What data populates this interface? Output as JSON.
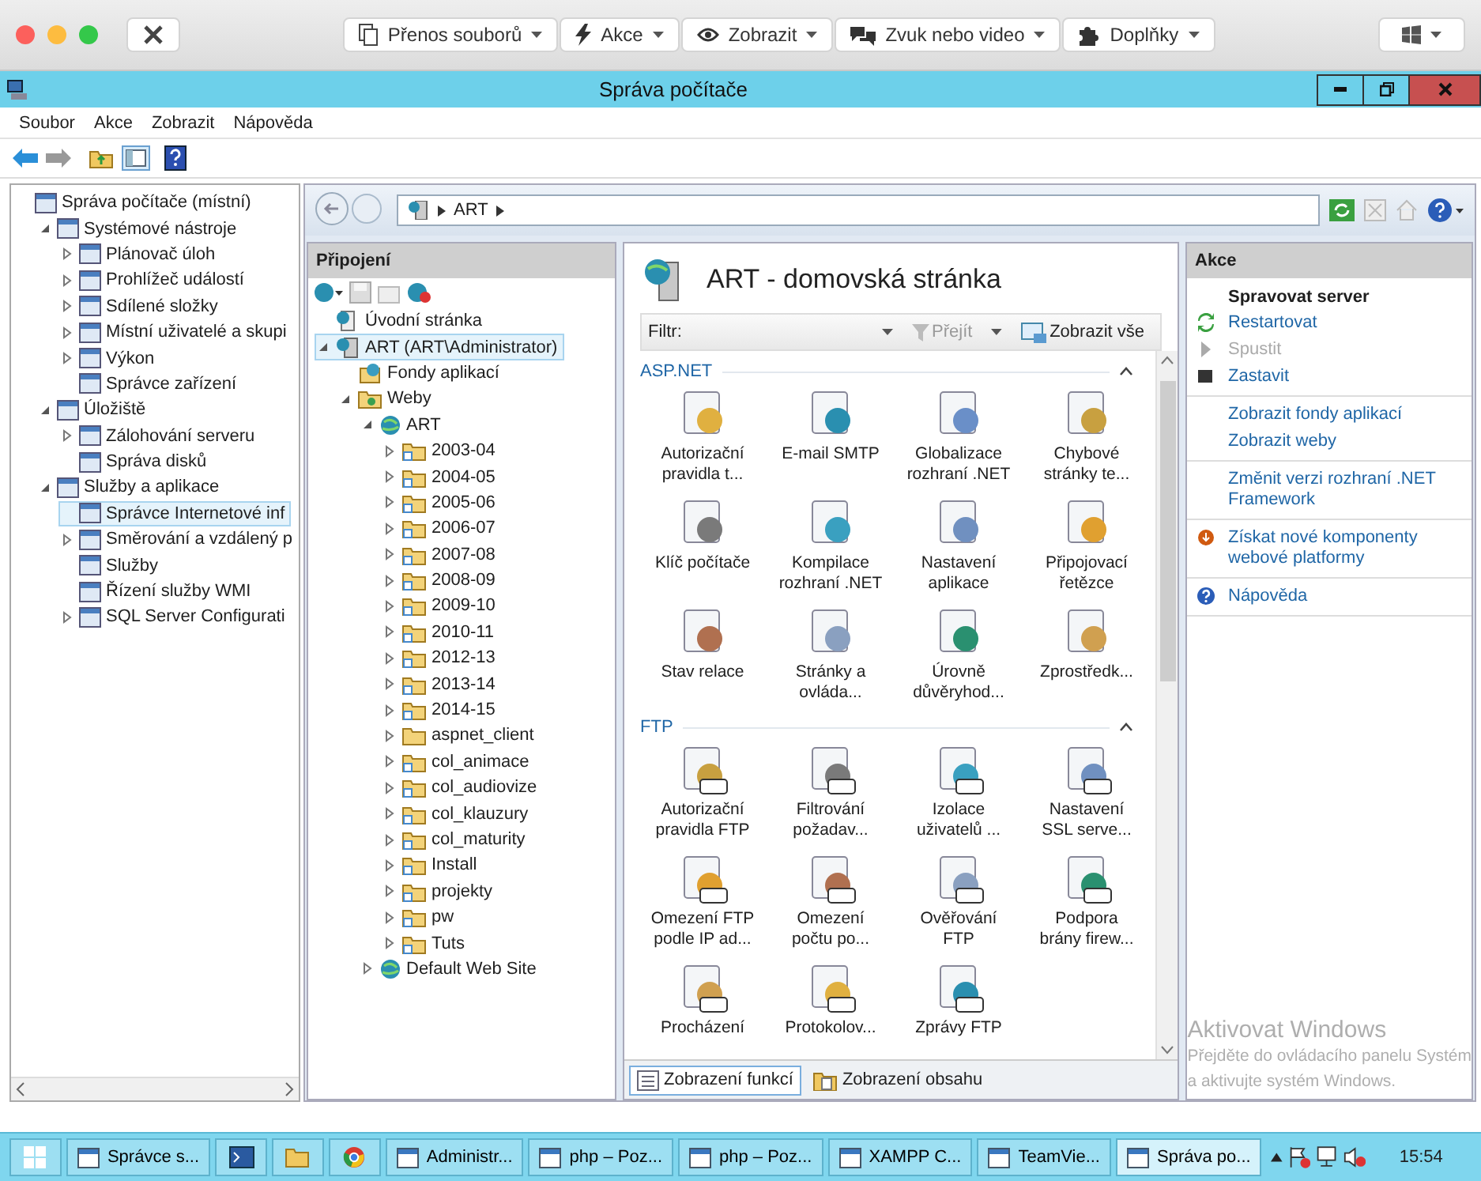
{
  "top_bar": {
    "buttons": [
      {
        "label": "Přenos souborů",
        "kind": "files"
      },
      {
        "label": "Akce",
        "kind": "bolt"
      },
      {
        "label": "Zobrazit",
        "kind": "eye"
      },
      {
        "label": "Zvuk nebo video",
        "kind": "chat"
      },
      {
        "label": "Doplňky",
        "kind": "puzzle"
      }
    ]
  },
  "window": {
    "title": "Správa počítače"
  },
  "menu": [
    "Soubor",
    "Akce",
    "Zobrazit",
    "Nápověda"
  ],
  "console_tree": [
    {
      "label": "Správa počítače (místní)",
      "selected": false,
      "children": [
        {
          "label": "Systémové nástroje",
          "expanded": true,
          "selected": false,
          "children": [
            {
              "label": "Plánovač úloh",
              "expanded": false,
              "selected": false
            },
            {
              "label": "Prohlížeč událostí",
              "expanded": false,
              "selected": false
            },
            {
              "label": "Sdílené složky",
              "expanded": false,
              "selected": false
            },
            {
              "label": "Místní uživatelé a skupi",
              "expanded": false,
              "selected": false
            },
            {
              "label": "Výkon",
              "expanded": false,
              "selected": false
            },
            {
              "label": "Správce zařízení",
              "selected": false
            }
          ]
        },
        {
          "label": "Úložiště",
          "expanded": true,
          "selected": false,
          "children": [
            {
              "label": "Zálohování serveru",
              "expanded": false,
              "selected": false
            },
            {
              "label": "Správa disků",
              "selected": false
            }
          ]
        },
        {
          "label": "Služby a aplikace",
          "expanded": true,
          "selected": false,
          "children": [
            {
              "label": "Správce Internetové inf",
              "selected": true
            },
            {
              "label": "Směrování a vzdálený p",
              "expanded": false,
              "selected": false
            },
            {
              "label": "Služby",
              "selected": false
            },
            {
              "label": "Řízení služby WMI",
              "selected": false
            },
            {
              "label": "SQL Server Configurati",
              "expanded": false,
              "selected": false
            }
          ]
        }
      ]
    }
  ],
  "address": {
    "crumbs": [
      "ART"
    ]
  },
  "connections": {
    "title": "Připojení",
    "tree": [
      {
        "label": "Úvodní stránka",
        "kind": "page",
        "selected": false
      },
      {
        "label": "ART (ART\\Administrator)",
        "kind": "server",
        "expanded": true,
        "selected": true,
        "children": [
          {
            "label": "Fondy aplikací",
            "kind": "pool",
            "selected": false
          },
          {
            "label": "Weby",
            "kind": "sites",
            "expanded": true,
            "selected": false,
            "children": [
              {
                "label": "ART",
                "kind": "site",
                "expanded": true,
                "selected": false,
                "children": [
                  {
                    "label": "2003-04",
                    "kind": "vdir",
                    "expanded": false,
                    "selected": false
                  },
                  {
                    "label": "2004-05",
                    "kind": "vdir",
                    "expanded": false,
                    "selected": false
                  },
                  {
                    "label": "2005-06",
                    "kind": "vdir",
                    "expanded": false,
                    "selected": false
                  },
                  {
                    "label": "2006-07",
                    "kind": "vdir",
                    "expanded": false,
                    "selected": false
                  },
                  {
                    "label": "2007-08",
                    "kind": "vdir",
                    "expanded": false,
                    "selected": false
                  },
                  {
                    "label": "2008-09",
                    "kind": "vdir",
                    "expanded": false,
                    "selected": false
                  },
                  {
                    "label": "2009-10",
                    "kind": "vdir",
                    "expanded": false,
                    "selected": false
                  },
                  {
                    "label": "2010-11",
                    "kind": "vdir",
                    "expanded": false,
                    "selected": false
                  },
                  {
                    "label": "2012-13",
                    "kind": "vdir",
                    "expanded": false,
                    "selected": false
                  },
                  {
                    "label": "2013-14",
                    "kind": "vdir",
                    "expanded": false,
                    "selected": false
                  },
                  {
                    "label": "2014-15",
                    "kind": "vdir",
                    "expanded": false,
                    "selected": false
                  },
                  {
                    "label": "aspnet_client",
                    "kind": "folder",
                    "expanded": false,
                    "selected": false
                  },
                  {
                    "label": "col_animace",
                    "kind": "vdir",
                    "expanded": false,
                    "selected": false
                  },
                  {
                    "label": "col_audiovize",
                    "kind": "vdir",
                    "expanded": false,
                    "selected": false
                  },
                  {
                    "label": "col_klauzury",
                    "kind": "vdir",
                    "expanded": false,
                    "selected": false
                  },
                  {
                    "label": "col_maturity",
                    "kind": "vdir",
                    "expanded": false,
                    "selected": false
                  },
                  {
                    "label": "Install",
                    "kind": "vdir",
                    "expanded": false,
                    "selected": false
                  },
                  {
                    "label": "projekty",
                    "kind": "vdir",
                    "expanded": false,
                    "selected": false
                  },
                  {
                    "label": "pw",
                    "kind": "vdir",
                    "expanded": false,
                    "selected": false
                  },
                  {
                    "label": "Tuts",
                    "kind": "vdir",
                    "expanded": false,
                    "selected": false
                  }
                ]
              },
              {
                "label": "Default Web Site",
                "kind": "site",
                "expanded": false,
                "selected": false
              }
            ]
          }
        ]
      }
    ]
  },
  "home": {
    "title": "ART - domovská stránka",
    "filter": {
      "label": "Filtr:",
      "go": "Přejít",
      "go_disabled": true,
      "show_all": "Zobrazit vše"
    },
    "groups": [
      {
        "title": "ASP.NET",
        "expanded": true,
        "items": [
          {
            "label": "Autorizační\npravidla t..."
          },
          {
            "label": "E-mail SMTP"
          },
          {
            "label": "Globalizace\nrozhraní .NET"
          },
          {
            "label": "Chybové\nstránky te..."
          },
          {
            "label": "Klíč počítače"
          },
          {
            "label": "Kompilace\nrozhraní .NET"
          },
          {
            "label": "Nastavení\naplikace"
          },
          {
            "label": "Připojovací\nřetězce"
          },
          {
            "label": "Stav relace"
          },
          {
            "label": "Stránky a\novláda..."
          },
          {
            "label": "Úrovně\ndůvěryhod..."
          },
          {
            "label": "Zprostředk..."
          }
        ]
      },
      {
        "title": "FTP",
        "expanded": true,
        "items": [
          {
            "label": "Autorizační\npravidla FTP"
          },
          {
            "label": "Filtrování\npožadav..."
          },
          {
            "label": "Izolace\nuživatelů ..."
          },
          {
            "label": "Nastavení\nSSL serve..."
          },
          {
            "label": "Omezení FTP\npodle IP ad..."
          },
          {
            "label": "Omezení\npočtu po..."
          },
          {
            "label": "Ověřování\nFTP"
          },
          {
            "label": "Podpora\nbrány firew..."
          },
          {
            "label": "Procházení"
          },
          {
            "label": "Protokolov..."
          },
          {
            "label": "Zprávy FTP"
          }
        ]
      }
    ]
  },
  "view_tabs": [
    {
      "label": "Zobrazení funkcí",
      "selected": true
    },
    {
      "label": "Zobrazení obsahu",
      "selected": false
    }
  ],
  "actions": {
    "title": "Akce",
    "sections": [
      {
        "heading": "Spravovat server",
        "items": [
          {
            "label": "Restartovat",
            "kind": "restart",
            "disabled": false
          },
          {
            "label": "Spustit",
            "kind": "start",
            "disabled": true
          },
          {
            "label": "Zastavit",
            "kind": "stop",
            "disabled": false
          }
        ]
      },
      {
        "items": [
          {
            "label": "Zobrazit fondy aplikací",
            "kind": "link",
            "disabled": false
          },
          {
            "label": "Zobrazit weby",
            "kind": "link",
            "disabled": false
          }
        ]
      },
      {
        "items": [
          {
            "label": "Změnit verzi rozhraní .NET Framework",
            "kind": "link",
            "disabled": false
          }
        ]
      },
      {
        "items": [
          {
            "label": "Získat nové komponenty webové platformy",
            "kind": "download",
            "disabled": false
          }
        ]
      },
      {
        "items": [
          {
            "label": "Nápověda",
            "kind": "help",
            "disabled": false
          }
        ]
      }
    ]
  },
  "activation_notice": [
    "Aktivovat Windows",
    "Přejděte do ovládacího panelu Systém",
    "a aktivujte systém Windows."
  ],
  "taskbar": {
    "items": [
      {
        "kind": "window",
        "label": "Správce s...",
        "selected": false
      },
      {
        "kind": "terminal",
        "selected": false
      },
      {
        "kind": "explorer",
        "selected": false
      },
      {
        "kind": "browser",
        "selected": false
      },
      {
        "kind": "window",
        "label": "Administr...",
        "selected": false
      },
      {
        "kind": "window",
        "label": "php – Poz...",
        "selected": false
      },
      {
        "kind": "window",
        "label": "php – Poz...",
        "selected": false
      },
      {
        "kind": "window",
        "label": "XAMPP C...",
        "selected": false
      },
      {
        "kind": "window",
        "label": "TeamVie...",
        "selected": false
      },
      {
        "kind": "window",
        "label": "Správa po...",
        "selected": true
      }
    ],
    "clock": "15:54"
  }
}
